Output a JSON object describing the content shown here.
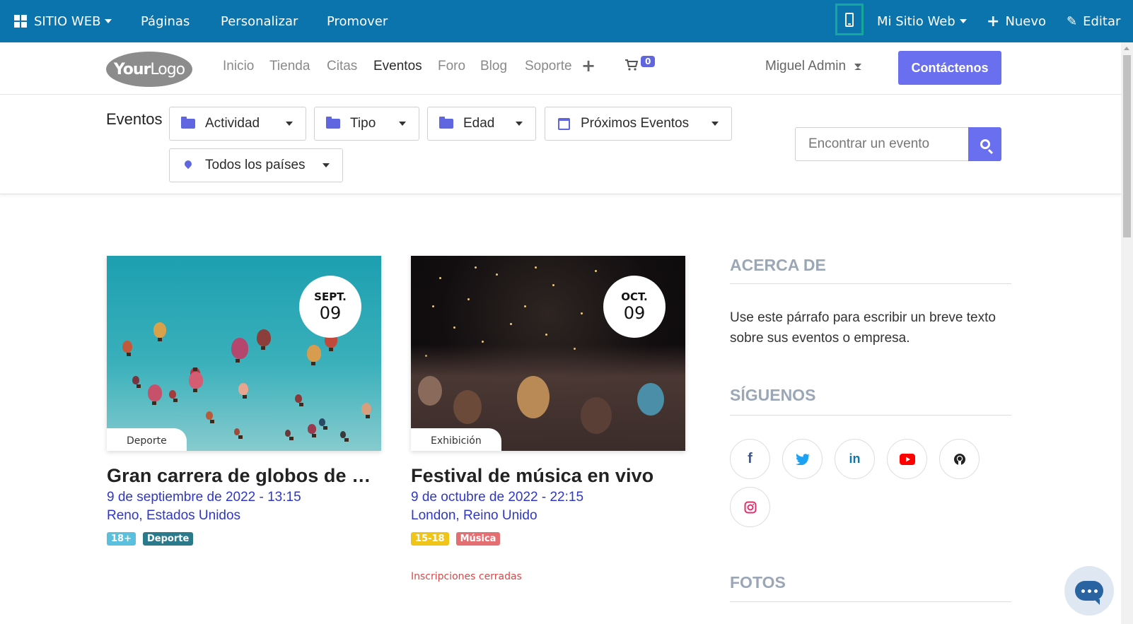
{
  "admin_bar": {
    "site_menu": "SITIO WEB",
    "pages": "Páginas",
    "customize": "Personalizar",
    "promote": "Promover",
    "website_menu": "Mi Sitio Web",
    "new": "Nuevo",
    "edit": "Editar",
    "bg_color": "#0b74ad"
  },
  "header": {
    "logo_bold": "Your",
    "logo_light": "Logo",
    "nav": [
      "Inicio",
      "Tienda",
      "Citas",
      "Eventos",
      "Foro",
      "Blog",
      "Soporte"
    ],
    "active_nav": "Eventos",
    "cart_count": "0",
    "user": "Miguel Admin",
    "contact": "Contáctenos",
    "accent": "#6a6ff0"
  },
  "filters": {
    "title": "Eventos",
    "activity": "Actividad",
    "type": "Tipo",
    "age": "Edad",
    "upcoming": "Próximos Eventos",
    "countries": "Todos los países",
    "search_placeholder": "Encontrar un evento"
  },
  "events": [
    {
      "month": "SEPT.",
      "day": "09",
      "category": "Deporte",
      "title": "Gran carrera de globos de aire caliente",
      "date": "9 de septiembre de 2022 - 13:15",
      "location": "Reno, Estados Unidos",
      "tags": [
        {
          "label": "18+",
          "color": "#5bc0de"
        },
        {
          "label": "Deporte",
          "color": "#2b7a8c"
        }
      ]
    },
    {
      "month": "OCT.",
      "day": "09",
      "category": "Exhibición",
      "title": "Festival de música en vivo",
      "date": "9 de octubre de 2022 - 22:15",
      "location": "London, Reino Unido",
      "tags": [
        {
          "label": "15-18",
          "color": "#f0c419"
        },
        {
          "label": "Música",
          "color": "#e46f73"
        }
      ],
      "status": "Inscripciones cerradas"
    }
  ],
  "sidebar": {
    "about_title": "ACERCA DE",
    "about_text": "Use este párrafo para escribir un breve texto sobre sus eventos o empresa.",
    "follow_title": "SÍGUENOS",
    "social": [
      {
        "icon": "facebook-icon",
        "glyph": "f",
        "color": "#3b5998"
      },
      {
        "icon": "twitter-icon",
        "glyph": "🐦",
        "color": "#1da1f2"
      },
      {
        "icon": "linkedin-icon",
        "glyph": "in",
        "color": "#0e76a8"
      },
      {
        "icon": "youtube-icon",
        "glyph": "▶",
        "color": "#ff0000"
      },
      {
        "icon": "github-icon",
        "glyph": "◕",
        "color": "#222222"
      },
      {
        "icon": "instagram-icon",
        "glyph": "◎",
        "color": "#e1306c"
      }
    ],
    "photos_title": "FOTOS"
  }
}
